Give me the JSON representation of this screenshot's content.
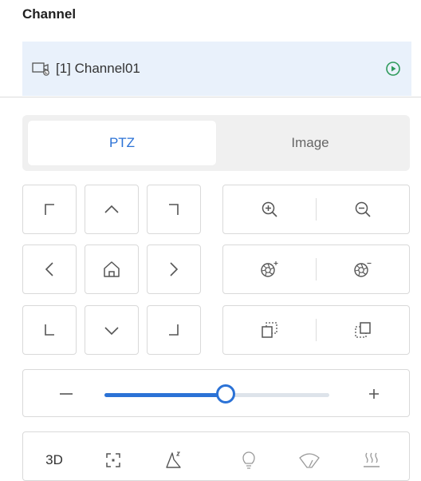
{
  "channel": {
    "title": "Channel",
    "selected_label": "[1] Channel01",
    "row_bg": "#e9f1fb"
  },
  "tabs": [
    {
      "label": "PTZ",
      "active": true
    },
    {
      "label": "Image",
      "active": false
    }
  ],
  "ptz": {
    "direction_buttons": [
      "up-left",
      "up",
      "up-right",
      "left",
      "home",
      "right",
      "down-left",
      "down",
      "down-right"
    ],
    "zoom": [
      "zoom-in",
      "zoom-out"
    ],
    "focus": [
      "focus-near",
      "focus-far"
    ],
    "iris": [
      "iris-open",
      "iris-close"
    ],
    "speed": {
      "value": 0.54,
      "minus": "−",
      "plus": "+"
    },
    "tools": {
      "label_3d": "3D"
    }
  },
  "colors": {
    "accent": "#2b72d6",
    "border": "#d9d9d9",
    "icon": "#555555"
  }
}
